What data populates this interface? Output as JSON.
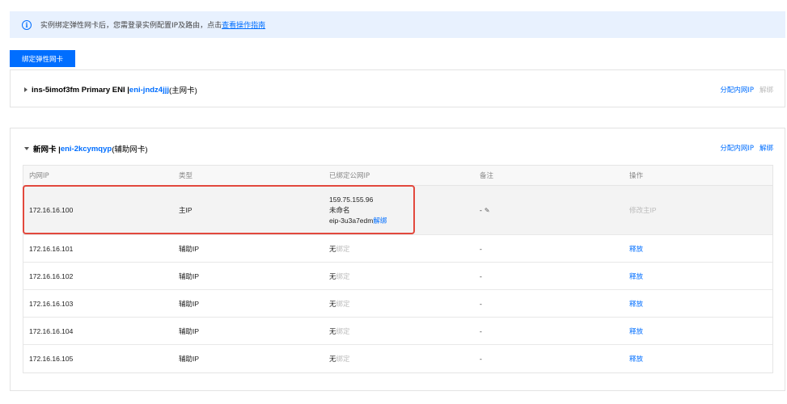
{
  "notice": {
    "icon": "info-icon",
    "text": "实例绑定弹性网卡后，您需登录实例配置IP及路由，点击",
    "link": "查看操作指南"
  },
  "bind_button": "绑定弹性网卡",
  "eni1": {
    "name": "ins-5imof3fm Primary ENI | ",
    "id": "eni-jndz4jjj",
    "type": "(主网卡)",
    "actions": {
      "assign": "分配内网IP",
      "unbind": "解绑"
    }
  },
  "eni2": {
    "name": "新网卡 | ",
    "id": "eni-2kcymqyp",
    "type": "(辅助网卡)",
    "actions": {
      "assign": "分配内网IP",
      "unbind": "解绑"
    },
    "columns": [
      "内网IP",
      "类型",
      "已绑定公网IP",
      "备注",
      "操作"
    ],
    "rows": [
      {
        "ip": "172.16.16.100",
        "type": "主IP",
        "eip_addr": "159.75.155.96",
        "eip_name": "未命名",
        "eip_id": "eip-3u3a7edm",
        "eip_unbind": "解绑",
        "note": "-",
        "action": "修改主IP"
      },
      {
        "ip": "172.16.16.101",
        "type": "辅助IP",
        "eip_none": "无",
        "eip_bind": "绑定",
        "note": "-",
        "action": "释放"
      },
      {
        "ip": "172.16.16.102",
        "type": "辅助IP",
        "eip_none": "无",
        "eip_bind": "绑定",
        "note": "-",
        "action": "释放"
      },
      {
        "ip": "172.16.16.103",
        "type": "辅助IP",
        "eip_none": "无",
        "eip_bind": "绑定",
        "note": "-",
        "action": "释放"
      },
      {
        "ip": "172.16.16.104",
        "type": "辅助IP",
        "eip_none": "无",
        "eip_bind": "绑定",
        "note": "-",
        "action": "释放"
      },
      {
        "ip": "172.16.16.105",
        "type": "辅助IP",
        "eip_none": "无",
        "eip_bind": "绑定",
        "note": "-",
        "action": "释放"
      }
    ]
  },
  "colors": {
    "accent": "#006eff",
    "highlight": "#e2483d"
  }
}
